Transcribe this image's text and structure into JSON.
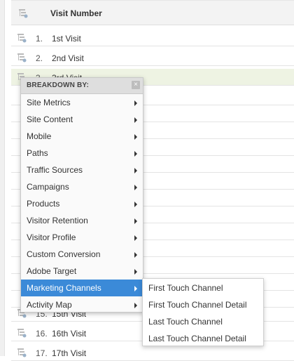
{
  "table": {
    "header": "Visit Number",
    "rows": [
      {
        "num": "1.",
        "label": "1st Visit"
      },
      {
        "num": "2.",
        "label": "2nd Visit"
      },
      {
        "num": "3.",
        "label": "3rd Visit"
      },
      {
        "num": "15.",
        "label": "15th Visit"
      },
      {
        "num": "16.",
        "label": "16th Visit"
      },
      {
        "num": "17.",
        "label": "17th Visit"
      }
    ]
  },
  "breakdown_menu": {
    "title": "BREAKDOWN BY:",
    "close": "×",
    "items": [
      {
        "label": "Site Metrics"
      },
      {
        "label": "Site Content"
      },
      {
        "label": "Mobile"
      },
      {
        "label": "Paths"
      },
      {
        "label": "Traffic Sources"
      },
      {
        "label": "Campaigns"
      },
      {
        "label": "Products"
      },
      {
        "label": "Visitor Retention"
      },
      {
        "label": "Visitor Profile"
      },
      {
        "label": "Custom Conversion"
      },
      {
        "label": "Adobe Target"
      },
      {
        "label": "Marketing Channels"
      },
      {
        "label": "Activity Map"
      }
    ],
    "active_item": "Marketing Channels"
  },
  "submenu": {
    "items": [
      {
        "label": "First Touch Channel"
      },
      {
        "label": "First Touch Channel Detail"
      },
      {
        "label": "Last Touch Channel"
      },
      {
        "label": "Last Touch Channel Detail"
      }
    ]
  },
  "colors": {
    "highlight_row": "#eef3e3",
    "active_menu": "#3b8ad8",
    "header_bg": "#f3f3f3"
  },
  "icons": {
    "breakdown": "breakdown-icon",
    "submenu_arrow": "chevron-right-icon",
    "close": "close-icon"
  }
}
